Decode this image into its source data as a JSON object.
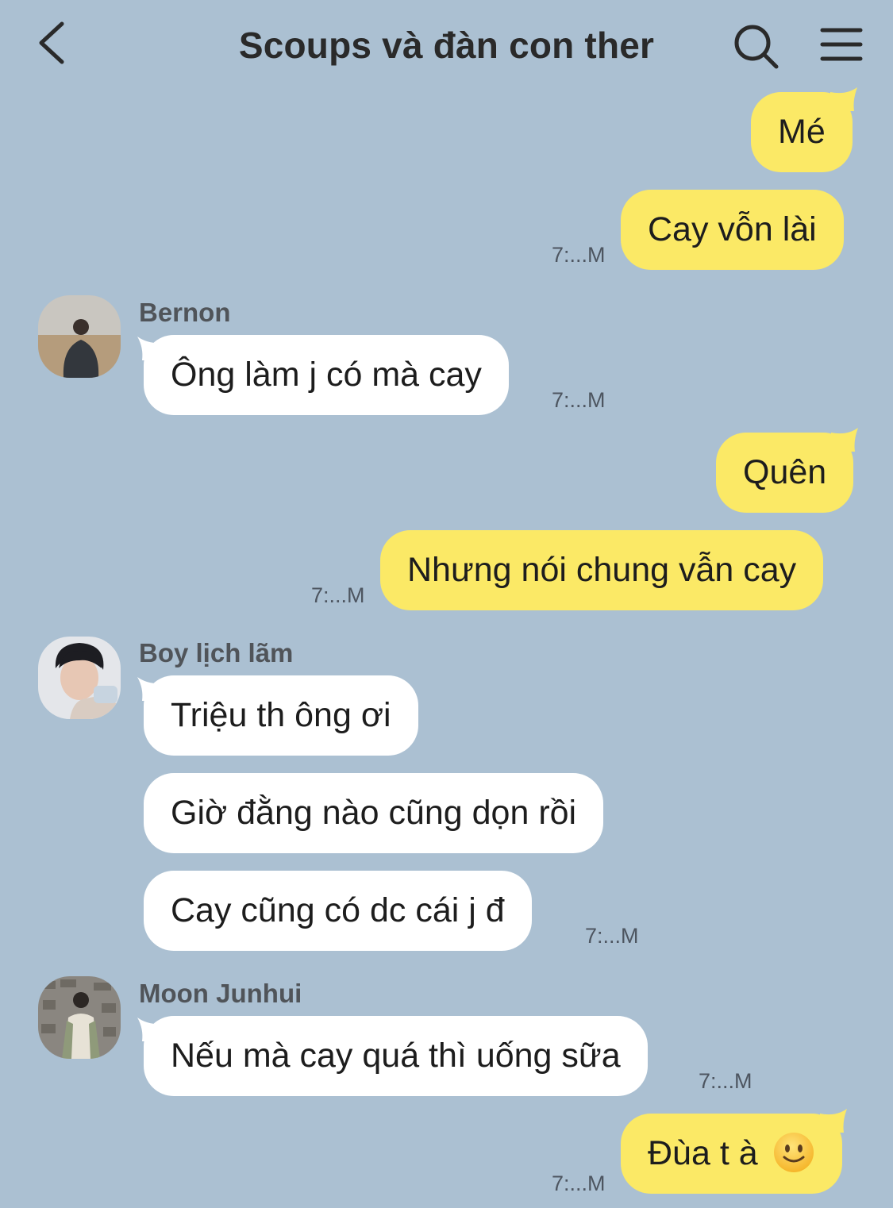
{
  "header": {
    "title": "Scoups và đàn con ther",
    "back_icon": "chevron-left-icon",
    "search_icon": "search-icon",
    "menu_icon": "hamburger-menu-icon"
  },
  "colors": {
    "background": "#abc0d2",
    "my_bubble": "#fbe966",
    "their_bubble": "#ffffff"
  },
  "messages": {
    "m1": {
      "text": "Mé"
    },
    "m2": {
      "text": "Cay vỗn lài",
      "time": "7:...M"
    },
    "m3": {
      "sender": "Bernon",
      "text": "Ông làm j có mà cay",
      "time": "7:...M"
    },
    "m4": {
      "text": "Quên"
    },
    "m5": {
      "text": "Nhưng nói chung vẫn cay",
      "time": "7:...M"
    },
    "m6": {
      "sender": "Boy lịch lãm",
      "text": "Triệu th ông ơi"
    },
    "m7": {
      "text": "Giờ đằng nào cũng dọn rồi"
    },
    "m8": {
      "text": "Cay cũng có dc cái j đ",
      "time": "7:...M"
    },
    "m9": {
      "sender": "Moon Junhui",
      "text": "Nếu mà cay quá thì uống sữa",
      "time": "7:...M"
    },
    "m10": {
      "text": "Đùa t à",
      "emoji": "slightly-smiling-face-icon",
      "time": "7:...M"
    }
  }
}
